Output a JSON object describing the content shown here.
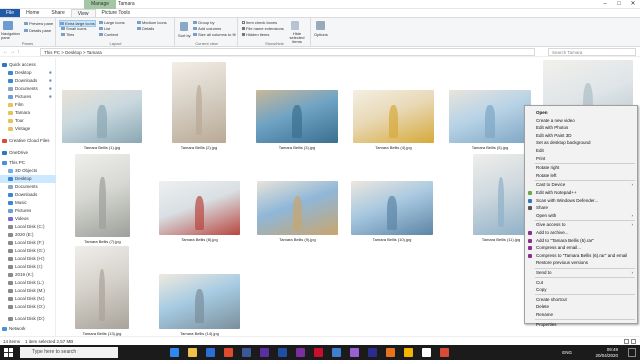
{
  "window": {
    "title": "Tamara",
    "manage_tab": "Manage"
  },
  "ribbon_tabs": [
    "File",
    "Home",
    "Share",
    "View",
    "Picture Tools"
  ],
  "ribbon": {
    "panes_items": [
      "Navigation pane",
      "Preview pane",
      "Details pane"
    ],
    "panes_label": "Panes",
    "layout_items": [
      "Extra large icons",
      "Large icons",
      "Medium icons",
      "Small icons",
      "List",
      "Details",
      "Tiles",
      "Content"
    ],
    "layout_label": "Layout",
    "sort_label": "Sort by",
    "current_view_items": [
      "Group by",
      "Add columns",
      "Size all columns to fit"
    ],
    "current_view_label": "Current view",
    "showhide_items": [
      "Item check boxes",
      "File name extensions",
      "Hidden items"
    ],
    "hide_selected": "Hide selected items",
    "showhide_label": "Show/hide",
    "options_label": "Options"
  },
  "address": {
    "path": "This PC  >  Desktop  >  Tamara",
    "search_placeholder": "Search Tamara"
  },
  "nav_items": [
    {
      "label": "Quick access",
      "icon": "star-icon",
      "color": "#2b78c5",
      "pinned": false
    },
    {
      "label": "Desktop",
      "icon": "desktop-folder-icon",
      "color": "#3a86d8",
      "pinned": true
    },
    {
      "label": "Downloads",
      "icon": "download-folder-icon",
      "color": "#3a86d8",
      "pinned": true
    },
    {
      "label": "Documents",
      "icon": "documents-folder-icon",
      "color": "#8aa6c2",
      "pinned": true
    },
    {
      "label": "Pictures",
      "icon": "pictures-folder-icon",
      "color": "#6aa0d8",
      "pinned": true
    },
    {
      "label": "Film",
      "icon": "folder-icon",
      "color": "#e8c35a",
      "pinned": false
    },
    {
      "label": "Tamara",
      "icon": "folder-icon",
      "color": "#e8c35a",
      "pinned": false
    },
    {
      "label": "Tour",
      "icon": "folder-icon",
      "color": "#e8c35a",
      "pinned": false
    },
    {
      "label": "Vintage",
      "icon": "folder-icon",
      "color": "#e8c35a",
      "pinned": false
    },
    {
      "label": "Creative Cloud Files",
      "icon": "creative-cloud-icon",
      "color": "#d94a3a",
      "pinned": false
    },
    {
      "label": "OneDrive",
      "icon": "onedrive-icon",
      "color": "#2b78c5",
      "pinned": false
    },
    {
      "label": "This PC",
      "icon": "computer-icon",
      "color": "#4a90d8",
      "pinned": false
    },
    {
      "label": "3D Objects",
      "icon": "3d-objects-icon",
      "color": "#6ab0e8",
      "pinned": false
    },
    {
      "label": "Desktop",
      "icon": "desktop-folder-icon",
      "color": "#3a86d8",
      "pinned": false
    },
    {
      "label": "Documents",
      "icon": "documents-folder-icon",
      "color": "#8aa6c2",
      "pinned": false
    },
    {
      "label": "Downloads",
      "icon": "download-folder-icon",
      "color": "#3a86d8",
      "pinned": false
    },
    {
      "label": "Music",
      "icon": "music-folder-icon",
      "color": "#3a86d8",
      "pinned": false
    },
    {
      "label": "Pictures",
      "icon": "pictures-folder-icon",
      "color": "#6aa0d8",
      "pinned": false
    },
    {
      "label": "Videos",
      "icon": "videos-folder-icon",
      "color": "#7a6ad8",
      "pinned": false
    },
    {
      "label": "Local Disk (C:)",
      "icon": "drive-icon",
      "color": "#8a8a8a",
      "pinned": false
    },
    {
      "label": "2020 (E:)",
      "icon": "drive-icon",
      "color": "#8a8a8a",
      "pinned": false
    },
    {
      "label": "Local Disk (F:)",
      "icon": "drive-icon",
      "color": "#8a8a8a",
      "pinned": false
    },
    {
      "label": "Local Disk (G:)",
      "icon": "drive-icon",
      "color": "#8a8a8a",
      "pinned": false
    },
    {
      "label": "Local Disk (H:)",
      "icon": "drive-icon",
      "color": "#8a8a8a",
      "pinned": false
    },
    {
      "label": "Local Disk (I:)",
      "icon": "drive-icon",
      "color": "#8a8a8a",
      "pinned": false
    },
    {
      "label": "2019 (K:)",
      "icon": "drive-icon",
      "color": "#8a8a8a",
      "pinned": false
    },
    {
      "label": "Local Disk (L:)",
      "icon": "drive-icon",
      "color": "#8a8a8a",
      "pinned": false
    },
    {
      "label": "Local Disk (M:)",
      "icon": "drive-icon",
      "color": "#8a8a8a",
      "pinned": false
    },
    {
      "label": "Local Disk (N:)",
      "icon": "drive-icon",
      "color": "#8a8a8a",
      "pinned": false
    },
    {
      "label": "Local Disk (O:)",
      "icon": "drive-icon",
      "color": "#8a8a8a",
      "pinned": false
    },
    {
      "label": "Local Disk (D:)",
      "icon": "drive-icon",
      "color": "#8a8a8a",
      "pinned": false
    },
    {
      "label": "Network",
      "icon": "network-icon",
      "color": "#4a90d8",
      "pinned": false
    }
  ],
  "files": [
    {
      "name": "Tamara Bellis (1).jpg",
      "colors": [
        "#c9d8df",
        "#8aa7b3",
        "#e9e2d6"
      ]
    },
    {
      "name": "Tamara Bellis (2).jpg",
      "colors": [
        "#d8d1c6",
        "#b9a996",
        "#f3eee7"
      ]
    },
    {
      "name": "Tamara Bellis (3).jpg",
      "colors": [
        "#6fa3c4",
        "#3a6f8e",
        "#c8b89a"
      ]
    },
    {
      "name": "Tamara Bellis (4).jpg",
      "colors": [
        "#e8d8b5",
        "#d6a93a",
        "#f4efe3"
      ]
    },
    {
      "name": "Tamara Bellis (5).jpg",
      "colors": [
        "#b8d3e6",
        "#7fa6c4",
        "#e8e4dd"
      ]
    },
    {
      "name": "Tamara Bellis (6).jpg",
      "colors": [
        "#dfe5e8",
        "#aebdc6",
        "#f2f0ec"
      ]
    },
    {
      "name": "Tamara Bellis (7).jpg",
      "colors": [
        "#d7d8d3",
        "#9da09a",
        "#eeeeea"
      ]
    },
    {
      "name": "Tamara Bellis (8).jpg",
      "colors": [
        "#d9dfe3",
        "#b8463f",
        "#eef0f0"
      ]
    },
    {
      "name": "Tamara Bellis (9).jpg",
      "colors": [
        "#8fb7d8",
        "#c9a56d",
        "#e8e3d9"
      ]
    },
    {
      "name": "Tamara Bellis (10).jpg",
      "colors": [
        "#a8c8e0",
        "#5d85a6",
        "#ece7de"
      ]
    },
    {
      "name": "Tamara Bellis (11).jpg",
      "colors": [
        "#cfd9df",
        "#8fb0c8",
        "#efeeea"
      ]
    },
    {
      "name": "Tamara Bellis (13).jpg",
      "colors": [
        "#d6d3cc",
        "#a9a39a",
        "#f0eeea"
      ]
    },
    {
      "name": "Tamara Bellis (14).jpg",
      "colors": [
        "#a6cbe2",
        "#7b8f9c",
        "#efe9df"
      ]
    }
  ],
  "status": {
    "count": "14 items",
    "selected": "1 item selected  2,57 MB"
  },
  "taskbar": {
    "search_placeholder": "Type here to search",
    "time": "09:49",
    "date": "20/04/2020",
    "lang": "ENG"
  },
  "context_menu": [
    {
      "label": "Open",
      "bold": true,
      "submenu": false,
      "icon": null
    },
    {
      "label": "Create a new video",
      "bold": false,
      "submenu": false,
      "icon": null
    },
    {
      "label": "Edit with Photos",
      "bold": false,
      "submenu": false,
      "icon": null
    },
    {
      "label": "Edit with Paint 3D",
      "bold": false,
      "submenu": false,
      "icon": null
    },
    {
      "label": "Set as desktop background",
      "bold": false,
      "submenu": false,
      "icon": null
    },
    {
      "label": "Edit",
      "bold": false,
      "submenu": false,
      "icon": null
    },
    {
      "label": "Print",
      "bold": false,
      "submenu": false,
      "icon": null
    },
    {
      "sep": true
    },
    {
      "label": "Rotate right",
      "bold": false,
      "submenu": false,
      "icon": null
    },
    {
      "label": "Rotate left",
      "bold": false,
      "submenu": false,
      "icon": null
    },
    {
      "sep": true
    },
    {
      "label": "Cast to Device",
      "bold": false,
      "submenu": true,
      "icon": null
    },
    {
      "label": "Edit with Notepad++",
      "bold": false,
      "submenu": false,
      "icon": "notepad-icon"
    },
    {
      "label": "Scan with Windows Defender...",
      "bold": false,
      "submenu": false,
      "icon": "defender-icon"
    },
    {
      "label": "Share",
      "bold": false,
      "submenu": false,
      "icon": "share-icon"
    },
    {
      "label": "Open with",
      "bold": false,
      "submenu": true,
      "icon": null
    },
    {
      "sep": true
    },
    {
      "label": "Give access to",
      "bold": false,
      "submenu": true,
      "icon": null
    },
    {
      "label": "Add to archive...",
      "bold": false,
      "submenu": false,
      "icon": "winrar-icon"
    },
    {
      "label": "Add to \"Tamara Bellis (6).rar\"",
      "bold": false,
      "submenu": false,
      "icon": "winrar-icon"
    },
    {
      "label": "Compress and email...",
      "bold": false,
      "submenu": false,
      "icon": "winrar-icon"
    },
    {
      "label": "Compress to \"Tamara Bellis (6).rar\" and email",
      "bold": false,
      "submenu": false,
      "icon": "winrar-icon"
    },
    {
      "label": "Restore previous versions",
      "bold": false,
      "submenu": false,
      "icon": null
    },
    {
      "sep": true
    },
    {
      "label": "Send to",
      "bold": false,
      "submenu": true,
      "icon": null
    },
    {
      "sep": true
    },
    {
      "label": "Cut",
      "bold": false,
      "submenu": false,
      "icon": null
    },
    {
      "label": "Copy",
      "bold": false,
      "submenu": false,
      "icon": null
    },
    {
      "sep": true
    },
    {
      "label": "Create shortcut",
      "bold": false,
      "submenu": false,
      "icon": null
    },
    {
      "label": "Delete",
      "bold": false,
      "submenu": false,
      "icon": null
    },
    {
      "label": "Rename",
      "bold": false,
      "submenu": false,
      "icon": null
    },
    {
      "sep": true
    },
    {
      "label": "Properties",
      "bold": false,
      "submenu": false,
      "icon": null
    }
  ]
}
